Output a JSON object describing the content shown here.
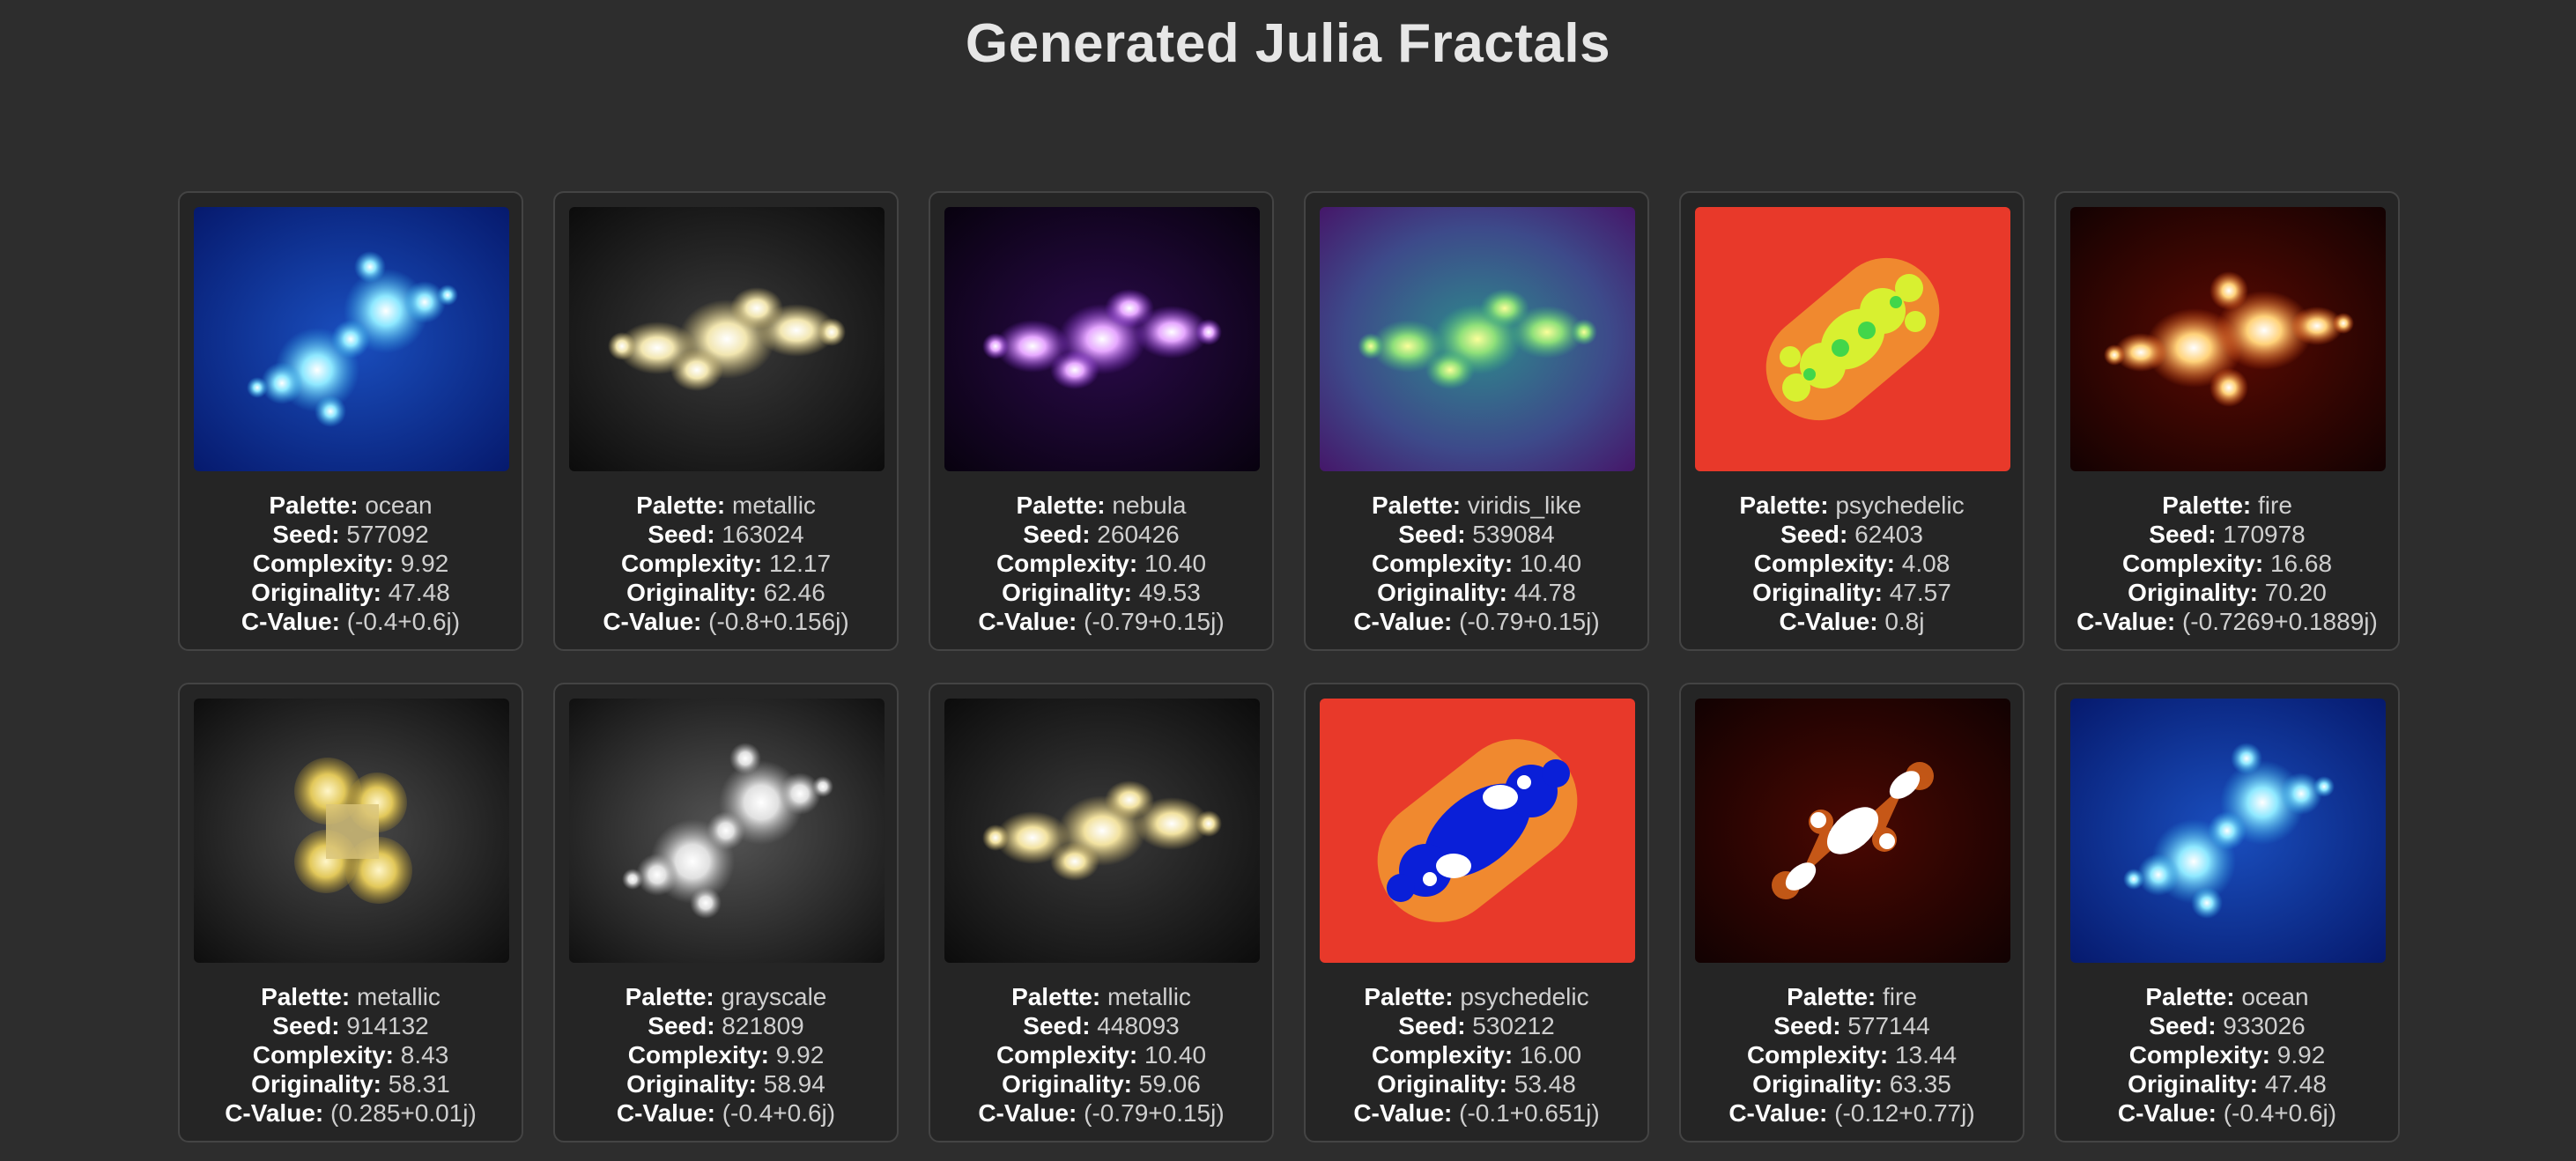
{
  "page": {
    "title": "Generated Julia Fractals"
  },
  "labels": {
    "palette": "Palette:",
    "seed": "Seed:",
    "complexity": "Complexity:",
    "originality": "Originality:",
    "cvalue": "C-Value:"
  },
  "fractals": [
    {
      "palette": "ocean",
      "seed": "577092",
      "complexity": "9.92",
      "originality": "47.48",
      "c_value": "(-0.4+0.6j)"
    },
    {
      "palette": "metallic",
      "seed": "163024",
      "complexity": "12.17",
      "originality": "62.46",
      "c_value": "(-0.8+0.156j)"
    },
    {
      "palette": "nebula",
      "seed": "260426",
      "complexity": "10.40",
      "originality": "49.53",
      "c_value": "(-0.79+0.15j)"
    },
    {
      "palette": "viridis_like",
      "seed": "539084",
      "complexity": "10.40",
      "originality": "44.78",
      "c_value": "(-0.79+0.15j)"
    },
    {
      "palette": "psychedelic",
      "seed": "62403",
      "complexity": "4.08",
      "originality": "47.57",
      "c_value": "0.8j"
    },
    {
      "palette": "fire",
      "seed": "170978",
      "complexity": "16.68",
      "originality": "70.20",
      "c_value": "(-0.7269+0.1889j)"
    },
    {
      "palette": "metallic",
      "seed": "914132",
      "complexity": "8.43",
      "originality": "58.31",
      "c_value": "(0.285+0.01j)"
    },
    {
      "palette": "grayscale",
      "seed": "821809",
      "complexity": "9.92",
      "originality": "58.94",
      "c_value": "(-0.4+0.6j)"
    },
    {
      "palette": "metallic",
      "seed": "448093",
      "complexity": "10.40",
      "originality": "59.06",
      "c_value": "(-0.79+0.15j)"
    },
    {
      "palette": "psychedelic",
      "seed": "530212",
      "complexity": "16.00",
      "originality": "53.48",
      "c_value": "(-0.1+0.651j)"
    },
    {
      "palette": "fire",
      "seed": "577144",
      "complexity": "13.44",
      "originality": "63.35",
      "c_value": "(-0.12+0.77j)"
    },
    {
      "palette": "ocean",
      "seed": "933026",
      "complexity": "9.92",
      "originality": "47.48",
      "c_value": "(-0.4+0.6j)"
    }
  ]
}
